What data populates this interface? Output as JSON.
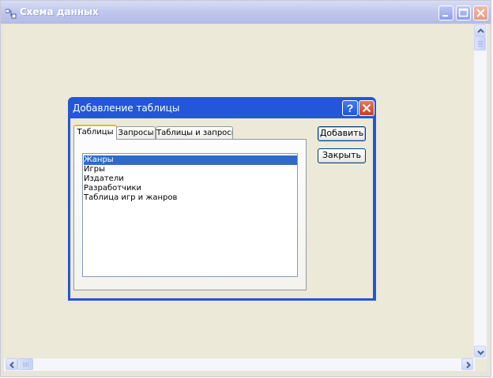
{
  "window": {
    "title": "Схема данных"
  },
  "dialog": {
    "title": "Добавление таблицы",
    "help_label": "?",
    "tabs": [
      {
        "label": "Таблицы",
        "active": true
      },
      {
        "label": "Запросы",
        "active": false
      },
      {
        "label": "Таблицы и запросы",
        "active": false
      }
    ],
    "tables": [
      {
        "label": "Жанры",
        "selected": true
      },
      {
        "label": "Игры",
        "selected": false
      },
      {
        "label": "Издатели",
        "selected": false
      },
      {
        "label": "Разработчики",
        "selected": false
      },
      {
        "label": "Таблица игр и жанров",
        "selected": false
      }
    ],
    "add_button": "Добавить",
    "close_button": "Закрыть"
  },
  "colors": {
    "dialog_titlebar": "#2356d8",
    "selection": "#316ac5",
    "workspace": "#ece9d8"
  }
}
